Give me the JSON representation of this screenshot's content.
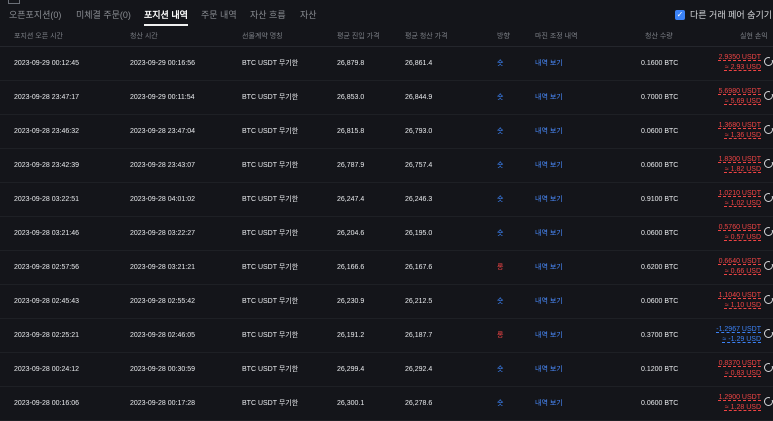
{
  "tabs": [
    {
      "label": "오픈포지션(0)"
    },
    {
      "label": "미체결 주문(0)"
    },
    {
      "label": "포지션 내역",
      "active": true
    },
    {
      "label": "주문 내역"
    },
    {
      "label": "자산 흐름"
    },
    {
      "label": "자산"
    }
  ],
  "hide_other_pairs": {
    "label": "다른 거래 페어 숨기기",
    "checked": true
  },
  "columns": [
    "포지션 오픈 시간",
    "청산 시간",
    "선물계약 명칭",
    "평균 진입 가격",
    "평균 청산 가격",
    "방향",
    "마진 조정 내역",
    "청산 수량",
    "실현 손익"
  ],
  "rows": [
    {
      "open": "2023-09-29 00:12:45",
      "close": "2023-09-29 00:16:56",
      "contract": "BTC USDT 무기한",
      "entry": "26,879.8",
      "exit": "26,861.4",
      "side": "숏",
      "margin": "내역 보기",
      "qty": "0.1600 BTC",
      "pnl_usdt": "2.9350 USDT",
      "pnl_usd": "≈ 2.93 USD",
      "pnl_sign": "pos"
    },
    {
      "open": "2023-09-28 23:47:17",
      "close": "2023-09-29 00:11:54",
      "contract": "BTC USDT 무기한",
      "entry": "26,853.0",
      "exit": "26,844.9",
      "side": "숏",
      "margin": "내역 보기",
      "qty": "0.7000 BTC",
      "pnl_usdt": "5.6980 USDT",
      "pnl_usd": "≈ 5.69 USD",
      "pnl_sign": "pos"
    },
    {
      "open": "2023-09-28 23:46:32",
      "close": "2023-09-28 23:47:04",
      "contract": "BTC USDT 무기한",
      "entry": "26,815.8",
      "exit": "26,793.0",
      "side": "숏",
      "margin": "내역 보기",
      "qty": "0.0600 BTC",
      "pnl_usdt": "1.3680 USDT",
      "pnl_usd": "≈ 1.36 USD",
      "pnl_sign": "pos"
    },
    {
      "open": "2023-09-28 23:42:39",
      "close": "2023-09-28 23:43:07",
      "contract": "BTC USDT 무기한",
      "entry": "26,787.9",
      "exit": "26,757.4",
      "side": "숏",
      "margin": "내역 보기",
      "qty": "0.0600 BTC",
      "pnl_usdt": "1.8300 USDT",
      "pnl_usd": "≈ 1.82 USD",
      "pnl_sign": "pos"
    },
    {
      "open": "2023-09-28 03:22:51",
      "close": "2023-09-28 04:01:02",
      "contract": "BTC USDT 무기한",
      "entry": "26,247.4",
      "exit": "26,246.3",
      "side": "숏",
      "margin": "내역 보기",
      "qty": "0.9100 BTC",
      "pnl_usdt": "1.0210 USDT",
      "pnl_usd": "≈ 1.02 USD",
      "pnl_sign": "pos"
    },
    {
      "open": "2023-09-28 03:21:46",
      "close": "2023-09-28 03:22:27",
      "contract": "BTC USDT 무기한",
      "entry": "26,204.6",
      "exit": "26,195.0",
      "side": "숏",
      "margin": "내역 보기",
      "qty": "0.0600 BTC",
      "pnl_usdt": "0.5760 USDT",
      "pnl_usd": "≈ 0.57 USD",
      "pnl_sign": "pos"
    },
    {
      "open": "2023-09-28 02:57:56",
      "close": "2023-09-28 03:21:21",
      "contract": "BTC USDT 무기한",
      "entry": "26,166.6",
      "exit": "26,167.6",
      "side": "롱",
      "margin": "내역 보기",
      "qty": "0.6200 BTC",
      "pnl_usdt": "0.6640 USDT",
      "pnl_usd": "≈ 0.66 USD",
      "pnl_sign": "pos"
    },
    {
      "open": "2023-09-28 02:45:43",
      "close": "2023-09-28 02:55:42",
      "contract": "BTC USDT 무기한",
      "entry": "26,230.9",
      "exit": "26,212.5",
      "side": "숏",
      "margin": "내역 보기",
      "qty": "0.0600 BTC",
      "pnl_usdt": "1.1040 USDT",
      "pnl_usd": "≈ 1.10 USD",
      "pnl_sign": "pos"
    },
    {
      "open": "2023-09-28 02:25:21",
      "close": "2023-09-28 02:46:05",
      "contract": "BTC USDT 무기한",
      "entry": "26,191.2",
      "exit": "26,187.7",
      "side": "롱",
      "margin": "내역 보기",
      "qty": "0.3700 BTC",
      "pnl_usdt": "-1.2967 USDT",
      "pnl_usd": "≈ -1.29 USD",
      "pnl_sign": "neg"
    },
    {
      "open": "2023-09-28 00:24:12",
      "close": "2023-09-28 00:30:59",
      "contract": "BTC USDT 무기한",
      "entry": "26,299.4",
      "exit": "26,292.4",
      "side": "숏",
      "margin": "내역 보기",
      "qty": "0.1200 BTC",
      "pnl_usdt": "0.8370 USDT",
      "pnl_usd": "≈ 0.83 USD",
      "pnl_sign": "pos"
    },
    {
      "open": "2023-09-28 00:16:06",
      "close": "2023-09-28 00:17:28",
      "contract": "BTC USDT 무기한",
      "entry": "26,300.1",
      "exit": "26,278.6",
      "side": "숏",
      "margin": "내역 보기",
      "qty": "0.0600 BTC",
      "pnl_usdt": "1.2900 USDT",
      "pnl_usd": "≈ 1.28 USD",
      "pnl_sign": "pos"
    }
  ],
  "colors": {
    "background": "#14151a",
    "accent": "#3b82f6",
    "buy": "#3b82f6",
    "sell": "#ef4444",
    "link": "#4a8cff"
  }
}
